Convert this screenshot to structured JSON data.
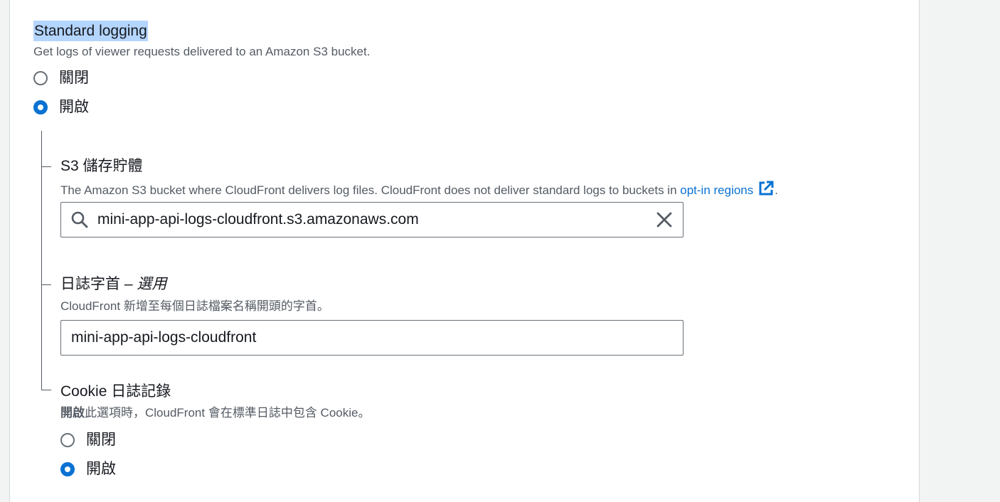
{
  "section": {
    "title": "Standard logging",
    "description": "Get logs of viewer requests delivered to an Amazon S3 bucket.",
    "options": [
      {
        "label": "關閉",
        "checked": false
      },
      {
        "label": "開啟",
        "checked": true
      }
    ]
  },
  "bucket": {
    "label": "S3 儲存貯體",
    "description": "The Amazon S3 bucket where CloudFront delivers log files. CloudFront does not deliver standard logs to buckets in ",
    "link_text": "opt-in regions",
    "description_end": ".",
    "value": "mini-app-api-logs-cloudfront.s3.amazonaws.com",
    "search_icon": "search-icon",
    "clear_icon": "close-icon",
    "external_icon": "external-link-icon"
  },
  "prefix": {
    "label": "日誌字首",
    "label_sep": " – ",
    "label_optional": "選用",
    "description": "CloudFront 新增至每個日誌檔案名稱開頭的字首。",
    "value": "mini-app-api-logs-cloudfront"
  },
  "cookie": {
    "label": "Cookie 日誌記錄",
    "description_bold": "開啟",
    "description": "此選項時，CloudFront 會在標準日誌中包含 Cookie。",
    "options": [
      {
        "label": "關閉",
        "checked": false
      },
      {
        "label": "開啟",
        "checked": true
      }
    ]
  },
  "colors": {
    "accent": "#0972d3",
    "highlight": "#b4d5fe",
    "secondary_text": "#545b64",
    "page_bg": "#f2f3f3"
  }
}
